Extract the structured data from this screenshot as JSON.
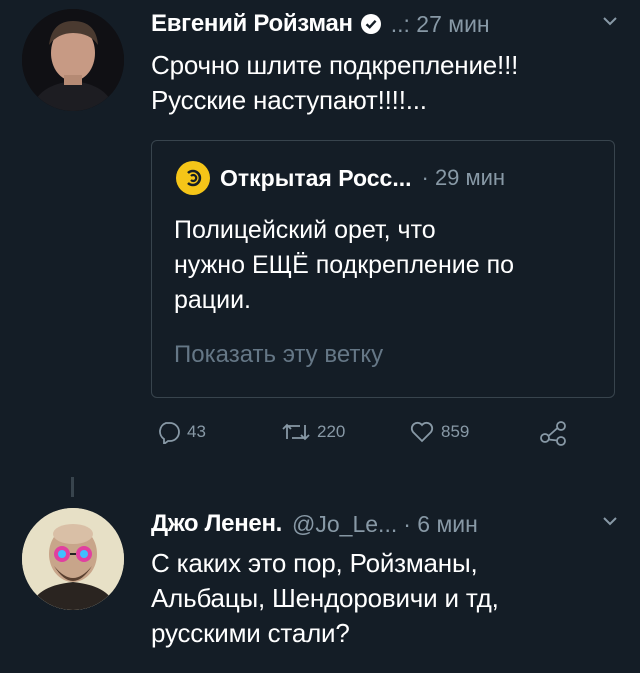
{
  "tweet1": {
    "author": "Евгений Ройзман",
    "meta": "..: 27 мин",
    "text_lines": [
      "Срочно шлите подкрепление!!!",
      "Русские наступают!!!!..."
    ],
    "quote": {
      "author": "Открытая Росс...",
      "time": "· 29 мин",
      "text_lines": [
        "Полицейский орет, что",
        "нужно ЕЩЁ подкрепление по",
        "рации."
      ],
      "show_thread": "Показать эту ветку"
    },
    "actions": {
      "replies": "43",
      "retweets": "220",
      "likes": "859"
    }
  },
  "tweet2": {
    "author": "Джо Ленен.",
    "handle": "@Jo_Le...",
    "time": "· 6 мин",
    "text_lines": [
      "С каких это пор, Ройзманы,",
      "Альбацы, Шендоровичи и тд,",
      "русскими стали?"
    ]
  },
  "colors": {
    "background": "#141d26",
    "secondary_text": "#8899a6",
    "border": "#38444d",
    "accent_logo": "#f5c518"
  }
}
